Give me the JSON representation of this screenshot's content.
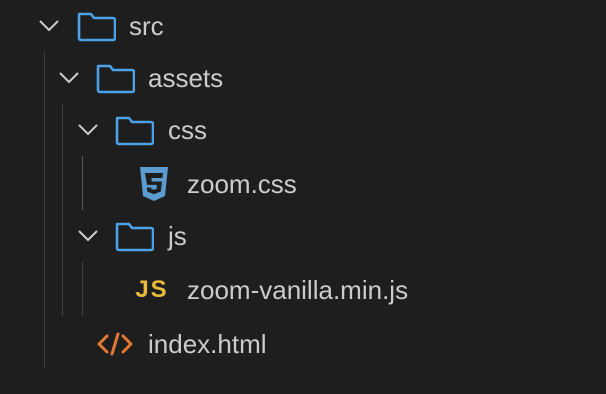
{
  "colors": {
    "background": "#1e1e1e",
    "text": "#cccccc",
    "folder_icon": "#4ba2e8",
    "css_icon": "#5c9bcf",
    "js_icon": "#e8bb3a",
    "html_icon": "#e37933",
    "chevron": "#cccccc",
    "indent_guide": "#404040"
  },
  "tree": {
    "src": {
      "label": "src",
      "icon": "folder-icon",
      "expanded": true
    },
    "assets": {
      "label": "assets",
      "icon": "folder-icon",
      "expanded": true
    },
    "css": {
      "label": "css",
      "icon": "folder-icon",
      "expanded": true
    },
    "zoom_css": {
      "label": "zoom.css",
      "icon": "css3-file-icon"
    },
    "js": {
      "label": "js",
      "icon": "folder-icon",
      "expanded": true
    },
    "zoom_js": {
      "label": "zoom-vanilla.min.js",
      "icon": "js-file-icon",
      "icon_text": "JS"
    },
    "index_html": {
      "label": "index.html",
      "icon": "html-file-icon"
    }
  }
}
